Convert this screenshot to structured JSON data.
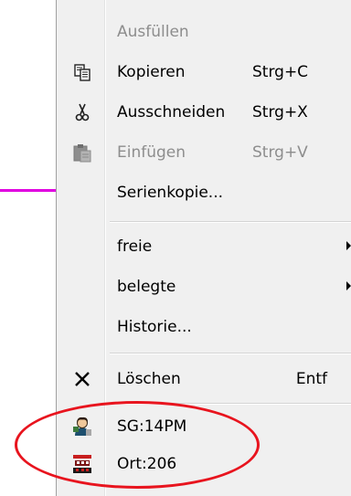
{
  "menu": {
    "items": [
      {
        "label": "Ausfüllen",
        "shortcut": "",
        "disabled": true,
        "icon": "none"
      },
      {
        "label": "Kopieren",
        "shortcut": "Strg+C",
        "disabled": false,
        "icon": "copy-icon"
      },
      {
        "label": "Ausschneiden",
        "shortcut": "Strg+X",
        "disabled": false,
        "icon": "scissors-icon"
      },
      {
        "label": "Einfügen",
        "shortcut": "Strg+V",
        "disabled": true,
        "icon": "paste-icon"
      },
      {
        "label": "Serienkopie...",
        "shortcut": "",
        "disabled": false,
        "icon": "none"
      },
      {
        "label": "freie",
        "shortcut": "",
        "disabled": false,
        "icon": "none",
        "submenu": true
      },
      {
        "label": "belegte",
        "shortcut": "",
        "disabled": false,
        "icon": "none",
        "submenu": true
      },
      {
        "label": "Historie...",
        "shortcut": "",
        "disabled": false,
        "icon": "none"
      },
      {
        "label": "Löschen",
        "shortcut": "Entf",
        "disabled": false,
        "icon": "delete-x-icon"
      },
      {
        "label": "SG:14PM",
        "shortcut": "",
        "disabled": false,
        "icon": "person-icon"
      },
      {
        "label": "Ort:206",
        "shortcut": "",
        "disabled": false,
        "icon": "building-icon"
      }
    ]
  },
  "annotation": {
    "highlight_color": "#e8141e",
    "pointer_line_color": "#e000e0"
  }
}
